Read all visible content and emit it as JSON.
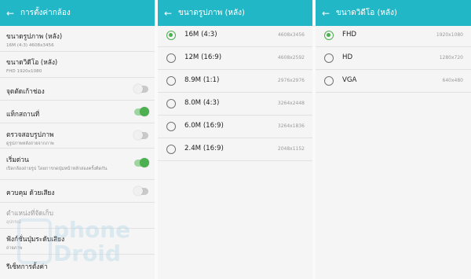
{
  "camera_settings": {
    "title": "การตั้งค่ากล้อง",
    "items": [
      {
        "label": "ขนาดรูปภาพ (หลัง)",
        "sub": "16M (4:3) 4608x3456"
      },
      {
        "label": "ขนาดวิดีโอ (หลัง)",
        "sub": "FHD 1920x1080"
      },
      {
        "label": "จุดตัดเก้าช่อง",
        "toggle": "off"
      },
      {
        "label": "แท็กสถานที่",
        "toggle": "on"
      },
      {
        "label": "ตรวจสอบรูปภาพ",
        "sub": "ดูรูปภาพหลังถ่ายจากภาพ",
        "toggle": "off"
      },
      {
        "label": "เริ่มด่วน",
        "sub": "เปิดกล้องถ่ายรูป โดยการกดปุ่มหน้าหลักสองครั้งติดกัน",
        "toggle": "on"
      },
      {
        "label": "ควบคุม ด้วยเสียง",
        "toggle": "off"
      },
      {
        "label": "ตำแหน่งที่จัดเก็บ",
        "sub": "อุปกรณ์",
        "disabled": true
      },
      {
        "label": "ฟังก์ชั่นปุ่มระดับเสียง",
        "sub": "ถ่ายภาพ"
      },
      {
        "label": "รีเซ็ทการตั้งค่า"
      }
    ]
  },
  "picture_size": {
    "title": "ขนาดรูปภาพ (หลัง)",
    "options": [
      {
        "label": "16M (4:3)",
        "res": "4608x3456",
        "selected": true
      },
      {
        "label": "12M (16:9)",
        "res": "4608x2592",
        "selected": false
      },
      {
        "label": "8.9M (1:1)",
        "res": "2976x2976",
        "selected": false
      },
      {
        "label": "8.0M (4:3)",
        "res": "3264x2448",
        "selected": false
      },
      {
        "label": "6.0M (16:9)",
        "res": "3264x1836",
        "selected": false
      },
      {
        "label": "2.4M (16:9)",
        "res": "2048x1152",
        "selected": false
      }
    ]
  },
  "video_size": {
    "title": "ขนาดวิดีโอ (หลัง)",
    "options": [
      {
        "label": "FHD",
        "res": "1920x1080",
        "selected": true
      },
      {
        "label": "HD",
        "res": "1280x720",
        "selected": false
      },
      {
        "label": "VGA",
        "res": "640x480",
        "selected": false
      }
    ]
  },
  "watermark": {
    "line1": "phone",
    "line2": "Droid"
  },
  "icons": {
    "back": "arrow-left-icon"
  },
  "colors": {
    "header": "#21b7c7",
    "accent": "#4caf50",
    "toggle_off": "#c9c9c9"
  }
}
